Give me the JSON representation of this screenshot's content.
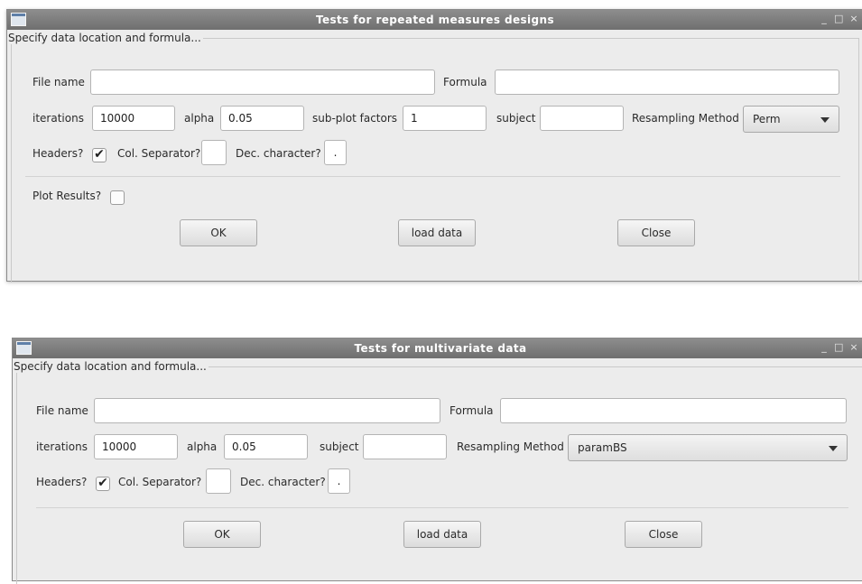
{
  "common": {
    "group_legend": "Specify data location and formula...",
    "file_name_label": "File name",
    "formula_label": "Formula",
    "iterations_label": "iterations",
    "alpha_label": "alpha",
    "subject_label": "subject",
    "resampling_label": "Resampling Method",
    "headers_label": "Headers?",
    "col_sep_label": "Col. Separator?",
    "dec_char_label": "Dec. character?",
    "ok_label": "OK",
    "load_label": "load data",
    "close_label": "Close",
    "minimize": "_",
    "maximize": "□",
    "close_x": "×",
    "check_mark": "✔"
  },
  "window1": {
    "title": "Tests for repeated measures designs",
    "file_name_value": "",
    "formula_value": "",
    "iterations_value": "10000",
    "alpha_value": "0.05",
    "subplot_label": "sub-plot factors",
    "subplot_value": "1",
    "subject_value": "",
    "resampling_value": "Perm",
    "headers_checked": true,
    "col_sep_value": "",
    "dec_char_value": ".",
    "plot_results_label": "Plot Results?",
    "plot_results_checked": false
  },
  "window2": {
    "title": "Tests for multivariate data",
    "file_name_value": "",
    "formula_value": "",
    "iterations_value": "10000",
    "alpha_value": "0.05",
    "subject_value": "",
    "resampling_value": "paramBS",
    "headers_checked": true,
    "col_sep_value": "",
    "dec_char_value": "."
  }
}
